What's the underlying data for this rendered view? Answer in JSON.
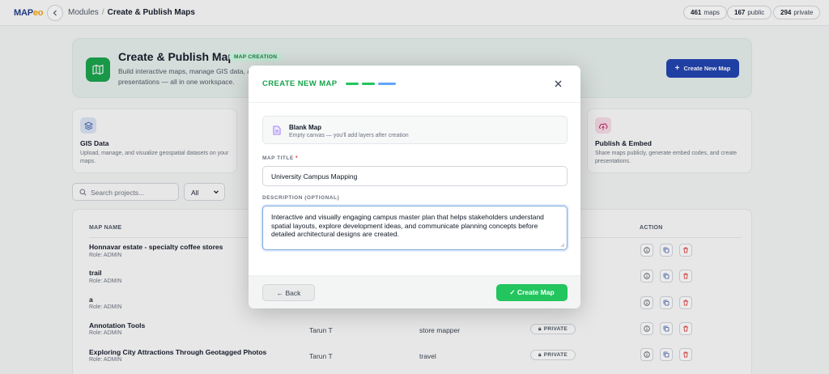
{
  "topbar": {
    "logo_main": "MAP",
    "logo_accent": "eo",
    "breadcrumb_root": "Modules",
    "breadcrumb_sep": "/",
    "breadcrumb_current": "Create & Publish Maps",
    "stats": [
      {
        "value": "461",
        "label": "maps"
      },
      {
        "value": "167",
        "label": "public"
      },
      {
        "value": "294",
        "label": "private"
      }
    ]
  },
  "hero": {
    "title": "Create & Publish Maps",
    "badge": "MAP CREATION",
    "description": "Build interactive maps, manage GIS data, a… presentations — all in one workspace.",
    "desc_line1": "Build interactive maps, manage GIS data, ar",
    "desc_line2": "presentations — all in one workspace.",
    "button_label": "Create New Map"
  },
  "features": [
    {
      "title": "GIS Data",
      "desc": "Upload, manage, and visualize geospatial datasets on your maps.",
      "icon": "layers-icon"
    },
    {
      "title": "Publish & Embed",
      "desc": "Share maps publicly, generate embed codes, and create presentations.",
      "icon": "cloud-upload-icon"
    }
  ],
  "search": {
    "placeholder": "Search projects...",
    "filter_value": "All"
  },
  "table": {
    "headers": {
      "name": "MAP NAME",
      "action": "ACTION"
    },
    "rows": [
      {
        "name": "Honnavar estate - specialty coffee stores",
        "role": "Role: ADMIN",
        "owner": "",
        "category": "",
        "visibility": ""
      },
      {
        "name": "trail",
        "role": "Role: ADMIN",
        "owner": "",
        "category": "",
        "visibility": ""
      },
      {
        "name": "a",
        "role": "Role: ADMIN",
        "owner": "",
        "category": "",
        "visibility": ""
      },
      {
        "name": "Annotation Tools",
        "role": "Role: ADMIN",
        "owner": "Tarun T",
        "category": "store mapper",
        "visibility": "PRIVATE"
      },
      {
        "name": "Exploring City Attractions Through Geotagged Photos",
        "role": "Role: ADMIN",
        "owner": "Tarun T",
        "category": "travel",
        "visibility": "PRIVATE"
      }
    ]
  },
  "modal": {
    "title": "CREATE NEW MAP",
    "steps_total": 3,
    "steps_active": 2,
    "template_title": "Blank Map",
    "template_desc": "Empty canvas — you'll add layers after creation",
    "title_label": "MAP TITLE",
    "title_required_mark": "*",
    "title_value": "University Campus Mapping",
    "desc_label": "DESCRIPTION (OPTIONAL)",
    "desc_value": "Interactive and visually engaging campus master plan that helps stakeholders understand spatial layouts, explore development ideas, and communicate planning concepts before detailed architectural designs are created.",
    "back_label": "← Back",
    "create_label": "✓ Create Map"
  },
  "colors": {
    "accent_green": "#16a34a",
    "primary_blue": "#1e40af",
    "step_inactive": "#60a5fa",
    "danger_red": "#dc2626"
  }
}
